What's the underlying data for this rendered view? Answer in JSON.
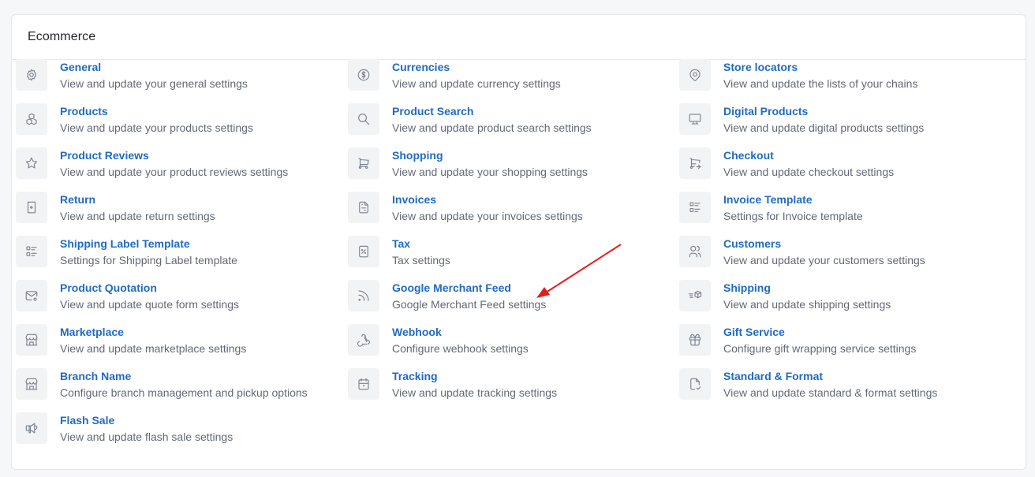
{
  "card": {
    "title": "Ecommerce"
  },
  "colors": {
    "link": "#206bc4",
    "muted": "#626976",
    "icon_bg": "#f1f3f5",
    "arrow": "#e02020"
  },
  "columns": [
    {
      "items": [
        {
          "title": "General",
          "desc": "View and update your general settings",
          "icon": "gear-icon"
        },
        {
          "title": "Products",
          "desc": "View and update your products settings",
          "icon": "cubes-icon"
        },
        {
          "title": "Product Reviews",
          "desc": "View and update your product reviews settings",
          "icon": "star-icon"
        },
        {
          "title": "Return",
          "desc": "View and update return settings",
          "icon": "return-receipt-icon"
        },
        {
          "title": "Shipping Label Template",
          "desc": "Settings for Shipping Label template",
          "icon": "list-details-icon"
        },
        {
          "title": "Product Quotation",
          "desc": "View and update quote form settings",
          "icon": "mail-cog-icon"
        },
        {
          "title": "Marketplace",
          "desc": "View and update marketplace settings",
          "icon": "store-icon"
        },
        {
          "title": "Branch Name",
          "desc": "Configure branch management and pickup options",
          "icon": "building-store-icon"
        },
        {
          "title": "Flash Sale",
          "desc": "View and update flash sale settings",
          "icon": "speakerphone-icon"
        }
      ]
    },
    {
      "items": [
        {
          "title": "Currencies",
          "desc": "View and update currency settings",
          "icon": "currency-dollar-icon"
        },
        {
          "title": "Product Search",
          "desc": "View and update product search settings",
          "icon": "search-icon"
        },
        {
          "title": "Shopping",
          "desc": "View and update your shopping settings",
          "icon": "shopping-cart-icon"
        },
        {
          "title": "Invoices",
          "desc": "View and update your invoices settings",
          "icon": "file-invoice-icon"
        },
        {
          "title": "Tax",
          "desc": "Tax settings",
          "icon": "receipt-tax-icon"
        },
        {
          "title": "Google Merchant Feed",
          "desc": "Google Merchant Feed settings",
          "icon": "rss-icon"
        },
        {
          "title": "Webhook",
          "desc": "Configure webhook settings",
          "icon": "webhook-icon"
        },
        {
          "title": "Tracking",
          "desc": "View and update tracking settings",
          "icon": "calendar-clock-icon"
        }
      ]
    },
    {
      "items": [
        {
          "title": "Store locators",
          "desc": "View and update the lists of your chains",
          "icon": "map-pin-icon"
        },
        {
          "title": "Digital Products",
          "desc": "View and update digital products settings",
          "icon": "monitor-icon"
        },
        {
          "title": "Checkout",
          "desc": "View and update checkout settings",
          "icon": "cart-arrow-icon"
        },
        {
          "title": "Invoice Template",
          "desc": "Settings for Invoice template",
          "icon": "list-details-icon"
        },
        {
          "title": "Customers",
          "desc": "View and update your customers settings",
          "icon": "users-icon"
        },
        {
          "title": "Shipping",
          "desc": "View and update shipping settings",
          "icon": "truck-delivery-icon"
        },
        {
          "title": "Gift Service",
          "desc": "Configure gift wrapping service settings",
          "icon": "gift-icon"
        },
        {
          "title": "Standard & Format",
          "desc": "View and update standard & format settings",
          "icon": "file-check-icon"
        }
      ]
    }
  ]
}
